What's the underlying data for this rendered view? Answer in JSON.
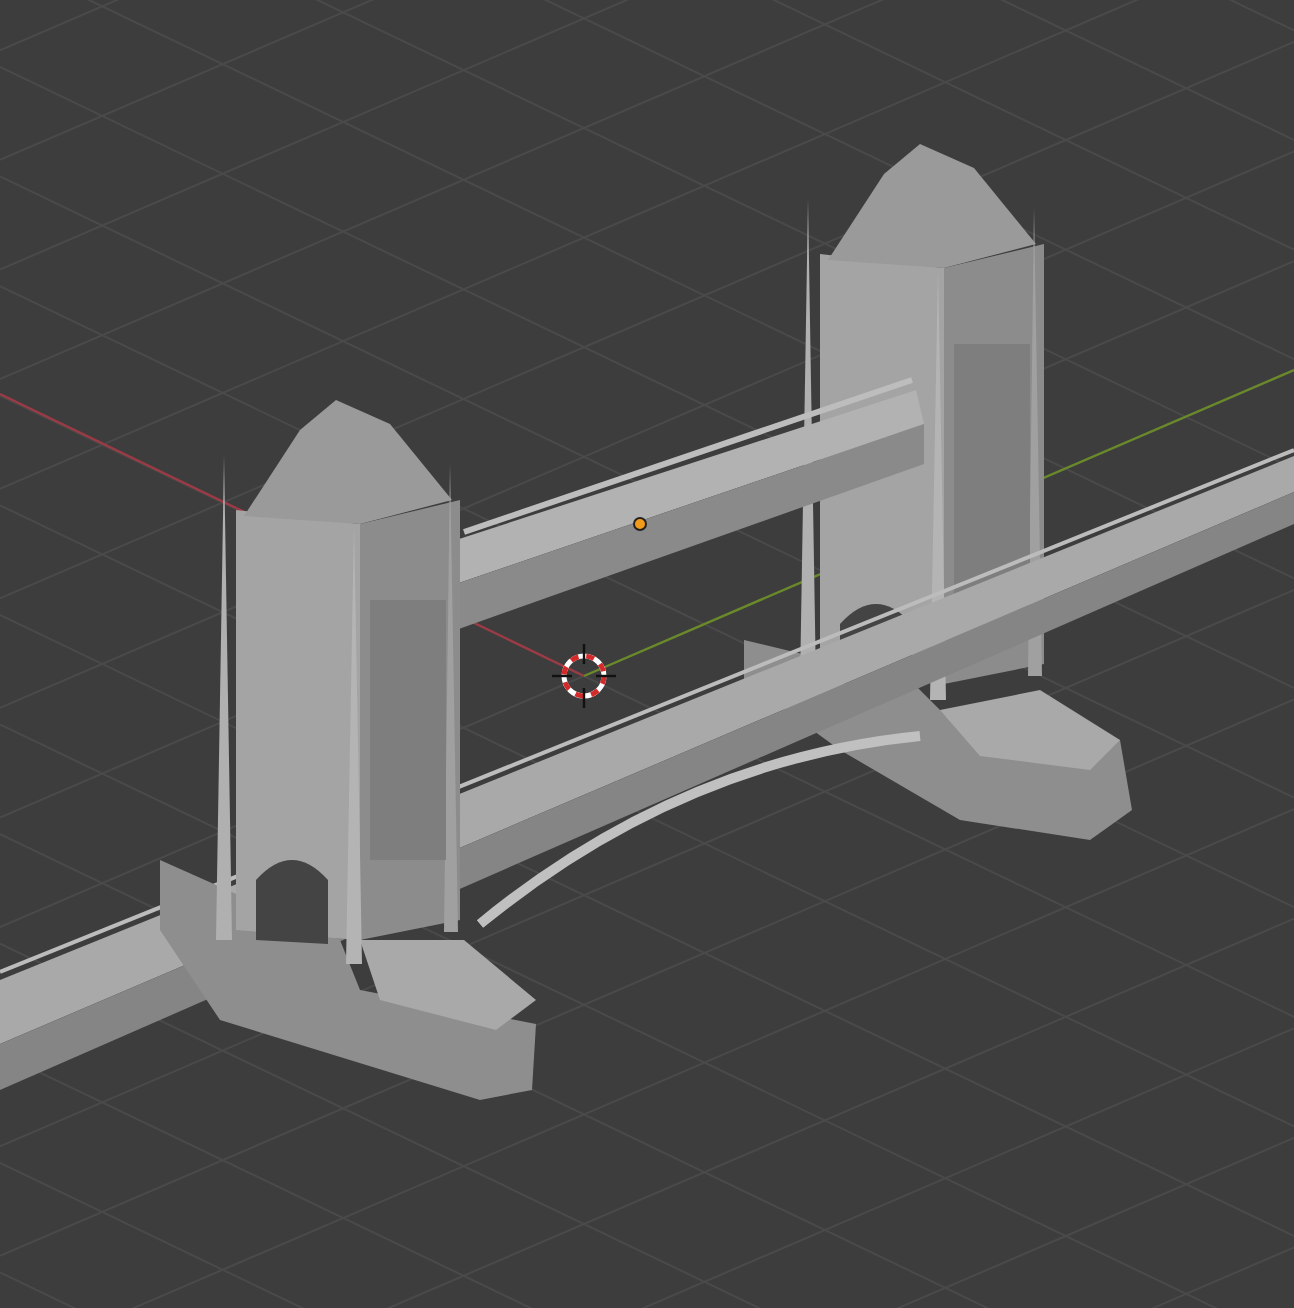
{
  "viewport": {
    "floor_grid": true,
    "axis_x": true,
    "axis_y": true,
    "cursor_3d": true,
    "origin_dot": true
  }
}
